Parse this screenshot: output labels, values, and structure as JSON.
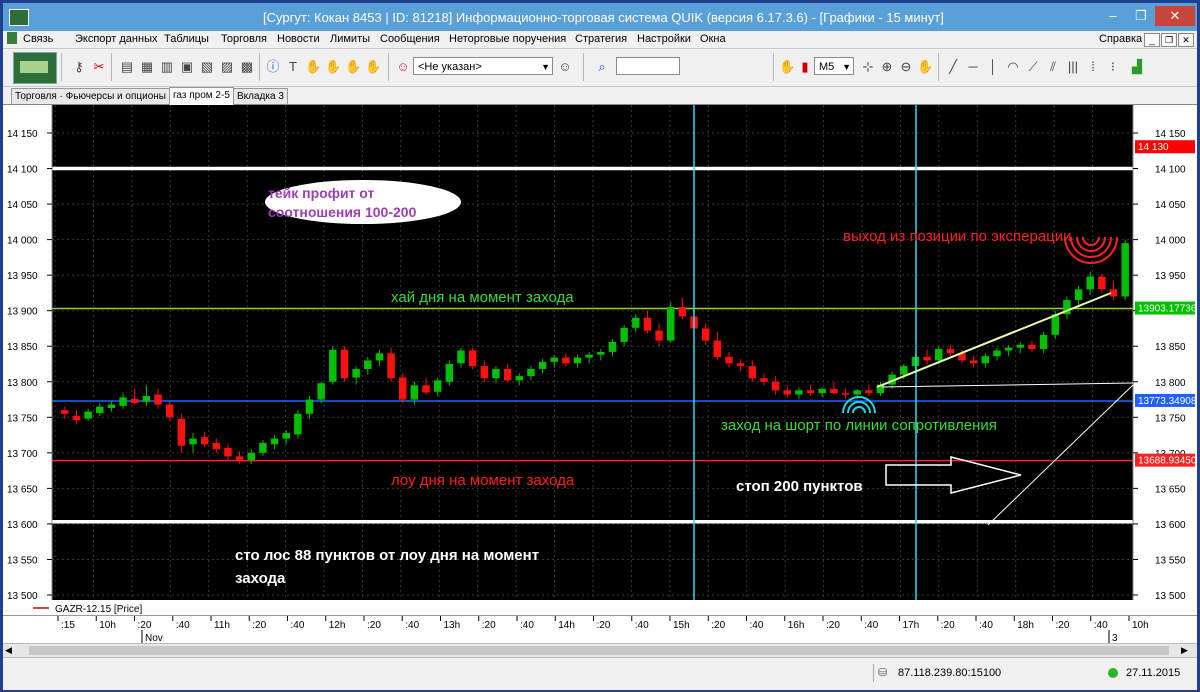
{
  "window": {
    "title": "[Сургут: Кокан 8453 | ID: 81218] Информационно-торговая система QUIK (версия 6.17.3.6) - [Графики - 15 минут]",
    "buttons": {
      "minimize": "–",
      "maximize": "❐",
      "close": "✕"
    }
  },
  "menu": [
    "Связь",
    "Экспорт данных",
    "Таблицы",
    "Торговля",
    "Новости",
    "Лимиты",
    "Сообщения",
    "Неторговые поручения",
    "Стратегия",
    "Настройки",
    "Окна"
  ],
  "menu_right": "Справка",
  "toolbar": {
    "account_select": "<Не указан>",
    "search_value": "",
    "interval_select": "M5"
  },
  "tabs": [
    "Торговля · Фьючерсы и опционы",
    "газ пром 2-5",
    "Вкладка 3"
  ],
  "active_tab": 1,
  "chart_data": {
    "type": "candlestick",
    "instrument_legend": "GAZR-12.15 [Price]",
    "ylim": [
      13500,
      14150
    ],
    "yticks": [
      "14 150",
      "14 100",
      "14 050",
      "14 000",
      "13 950",
      "13 900",
      "13 850",
      "13 800",
      "13 750",
      "13 700",
      "13 650",
      "13 600",
      "13 550",
      "13 500"
    ],
    "price_labels": [
      {
        "text": "14 130",
        "value": 14130,
        "color": "#ff0000"
      },
      {
        "text": "13903.17736",
        "value": 13903,
        "color": "#00c000"
      },
      {
        "text": "13773.34908",
        "value": 13773,
        "color": "#2060ff"
      },
      {
        "text": "13688.93450",
        "value": 13689,
        "color": "#ff2020"
      }
    ],
    "hlines": [
      {
        "value": 14100,
        "color": "#ffffff"
      },
      {
        "value": 13903,
        "color": "#9acd32"
      },
      {
        "value": 13773,
        "color": "#1e66ff"
      },
      {
        "value": 13689,
        "color": "#ff2020"
      },
      {
        "value": 13603,
        "color": "#ffffff"
      }
    ],
    "xticks": [
      ":15",
      "10h",
      ":20",
      ":40",
      "11h",
      ":20",
      ":40",
      "12h",
      ":20",
      ":40",
      "13h",
      ":20",
      ":40",
      "14h",
      ":20",
      ":40",
      "15h",
      ":20",
      ":40",
      "16h",
      ":20",
      ":40",
      "17h",
      ":20",
      ":40",
      "18h",
      ":20",
      ":40",
      "10h"
    ],
    "xticks_sub": [
      "Nov",
      "3"
    ],
    "candles": [
      [
        13760,
        13765,
        13748,
        13755
      ],
      [
        13752,
        13760,
        13740,
        13746
      ],
      [
        13748,
        13762,
        13745,
        13758
      ],
      [
        13756,
        13770,
        13752,
        13765
      ],
      [
        13763,
        13772,
        13758,
        13768
      ],
      [
        13766,
        13785,
        13762,
        13778
      ],
      [
        13776,
        13790,
        13768,
        13770
      ],
      [
        13772,
        13795,
        13765,
        13780
      ],
      [
        13782,
        13790,
        13762,
        13768
      ],
      [
        13768,
        13772,
        13745,
        13750
      ],
      [
        13748,
        13755,
        13700,
        13710
      ],
      [
        13712,
        13728,
        13700,
        13720
      ],
      [
        13722,
        13730,
        13708,
        13712
      ],
      [
        13714,
        13720,
        13700,
        13705
      ],
      [
        13707,
        13712,
        13690,
        13695
      ],
      [
        13695,
        13702,
        13685,
        13690
      ],
      [
        13690,
        13705,
        13684,
        13700
      ],
      [
        13700,
        13718,
        13696,
        13714
      ],
      [
        13712,
        13725,
        13705,
        13720
      ],
      [
        13720,
        13732,
        13712,
        13728
      ],
      [
        13726,
        13760,
        13720,
        13755
      ],
      [
        13755,
        13780,
        13748,
        13775
      ],
      [
        13775,
        13800,
        13770,
        13798
      ],
      [
        13800,
        13850,
        13796,
        13845
      ],
      [
        13845,
        13850,
        13800,
        13805
      ],
      [
        13806,
        13822,
        13796,
        13818
      ],
      [
        13818,
        13835,
        13810,
        13830
      ],
      [
        13830,
        13845,
        13822,
        13840
      ],
      [
        13840,
        13848,
        13800,
        13805
      ],
      [
        13806,
        13812,
        13770,
        13775
      ],
      [
        13775,
        13800,
        13768,
        13795
      ],
      [
        13795,
        13805,
        13782,
        13785
      ],
      [
        13786,
        13806,
        13780,
        13802
      ],
      [
        13800,
        13830,
        13795,
        13825
      ],
      [
        13826,
        13848,
        13820,
        13844
      ],
      [
        13844,
        13848,
        13818,
        13822
      ],
      [
        13822,
        13830,
        13800,
        13805
      ],
      [
        13805,
        13822,
        13798,
        13818
      ],
      [
        13818,
        13825,
        13800,
        13802
      ],
      [
        13802,
        13812,
        13795,
        13808
      ],
      [
        13808,
        13822,
        13802,
        13818
      ],
      [
        13818,
        13832,
        13812,
        13828
      ],
      [
        13828,
        13838,
        13820,
        13834
      ],
      [
        13834,
        13840,
        13822,
        13826
      ],
      [
        13826,
        13838,
        13820,
        13834
      ],
      [
        13834,
        13842,
        13826,
        13838
      ],
      [
        13838,
        13846,
        13830,
        13842
      ],
      [
        13842,
        13860,
        13836,
        13856
      ],
      [
        13856,
        13880,
        13850,
        13876
      ],
      [
        13876,
        13895,
        13870,
        13890
      ],
      [
        13890,
        13900,
        13868,
        13872
      ],
      [
        13872,
        13882,
        13850,
        13858
      ],
      [
        13858,
        13912,
        13855,
        13905
      ],
      [
        13905,
        13918,
        13888,
        13892
      ],
      [
        13892,
        13900,
        13870,
        13875
      ],
      [
        13875,
        13882,
        13852,
        13858
      ],
      [
        13858,
        13870,
        13830,
        13835
      ],
      [
        13835,
        13842,
        13820,
        13826
      ],
      [
        13826,
        13832,
        13815,
        13822
      ],
      [
        13822,
        13830,
        13800,
        13805
      ],
      [
        13805,
        13812,
        13795,
        13800
      ],
      [
        13800,
        13808,
        13782,
        13788
      ],
      [
        13788,
        13795,
        13778,
        13782
      ],
      [
        13782,
        13792,
        13776,
        13788
      ],
      [
        13788,
        13796,
        13780,
        13784
      ],
      [
        13784,
        13792,
        13778,
        13790
      ],
      [
        13790,
        13800,
        13782,
        13784
      ],
      [
        13784,
        13790,
        13776,
        13782
      ],
      [
        13782,
        13790,
        13776,
        13788
      ],
      [
        13788,
        13796,
        13780,
        13784
      ],
      [
        13784,
        13800,
        13780,
        13796
      ],
      [
        13796,
        13815,
        13790,
        13810
      ],
      [
        13810,
        13825,
        13804,
        13822
      ],
      [
        13822,
        13840,
        13816,
        13835
      ],
      [
        13835,
        13845,
        13825,
        13830
      ],
      [
        13830,
        13850,
        13825,
        13846
      ],
      [
        13846,
        13852,
        13836,
        13840
      ],
      [
        13840,
        13845,
        13826,
        13830
      ],
      [
        13830,
        13836,
        13820,
        13826
      ],
      [
        13826,
        13840,
        13820,
        13836
      ],
      [
        13836,
        13848,
        13830,
        13844
      ],
      [
        13844,
        13852,
        13836,
        13848
      ],
      [
        13848,
        13856,
        13840,
        13852
      ],
      [
        13852,
        13858,
        13842,
        13846
      ],
      [
        13846,
        13870,
        13840,
        13866
      ],
      [
        13866,
        13900,
        13860,
        13895
      ],
      [
        13895,
        13920,
        13888,
        13915
      ],
      [
        13915,
        13935,
        13905,
        13930
      ],
      [
        13930,
        13955,
        13922,
        13948
      ],
      [
        13948,
        13952,
        13925,
        13930
      ],
      [
        13930,
        13942,
        13915,
        13920
      ],
      [
        13920,
        14000,
        13915,
        13995
      ]
    ],
    "annotations": [
      {
        "text": "тейк профит от",
        "color": "#9b3fb5"
      },
      {
        "text": "соотношения 100-200",
        "color": "#9b3fb5"
      },
      {
        "text": "выход из позиции по эксперации",
        "color": "#ff2020"
      },
      {
        "text": "хай дня на момент захода",
        "color": "#3adb3a"
      },
      {
        "text": "заход на шорт по линии сопротивления",
        "color": "#3adb3a"
      },
      {
        "text": "лоу дня на момент захода",
        "color": "#ff2020"
      },
      {
        "text": "стоп 200 пунктов",
        "color": "#ffffff"
      },
      {
        "text": "сто лос 88 пунктов от лоу дня на момент",
        "color": "#ffffff"
      },
      {
        "text": "захода",
        "color": "#ffffff"
      }
    ]
  },
  "status": {
    "connection": "87.118.239.80:15100",
    "date": "27.11.2015"
  },
  "colors": {
    "chart_bg": "#000000",
    "up_candle": "#00c000",
    "down_candle": "#ff1010",
    "vertical_lines": "#3fd2e8",
    "titlebar": "#5aa0d8"
  }
}
